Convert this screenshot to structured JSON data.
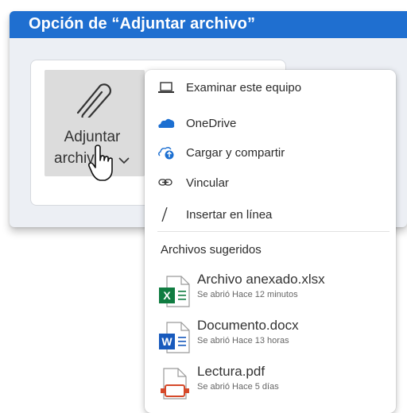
{
  "header": {
    "title": "Opción de “Adjuntar archivo”"
  },
  "attach": {
    "label_line1": "Adjuntar",
    "label_line2": "archivo"
  },
  "menu": {
    "items": [
      {
        "label": "Examinar este equipo",
        "icon": "laptop-icon"
      },
      {
        "label": "OneDrive",
        "icon": "onedrive-cloud-icon"
      },
      {
        "label": "Cargar y compartir",
        "icon": "cloud-upload-icon"
      },
      {
        "label": "Vincular",
        "icon": "link-icon"
      },
      {
        "label": "Insertar en línea",
        "icon": "slash-icon"
      }
    ],
    "suggested_title": "Archivos sugeridos",
    "files": [
      {
        "name": "Archivo anexado.xlsx",
        "meta": "Se abrió Hace 12 minutos",
        "icon": "excel-file-icon"
      },
      {
        "name": "Documento.docx",
        "meta": "Se abrió Hace 13 horas",
        "icon": "word-file-icon"
      },
      {
        "name": "Lectura.pdf",
        "meta": "Se abrió Hace 5 días",
        "icon": "pdf-file-icon"
      }
    ]
  },
  "colors": {
    "titlebar": "#1f6fd0",
    "onedrive": "#1c6fd1",
    "excel": "#107c41",
    "word": "#185abd",
    "pdf": "#d6492a"
  }
}
